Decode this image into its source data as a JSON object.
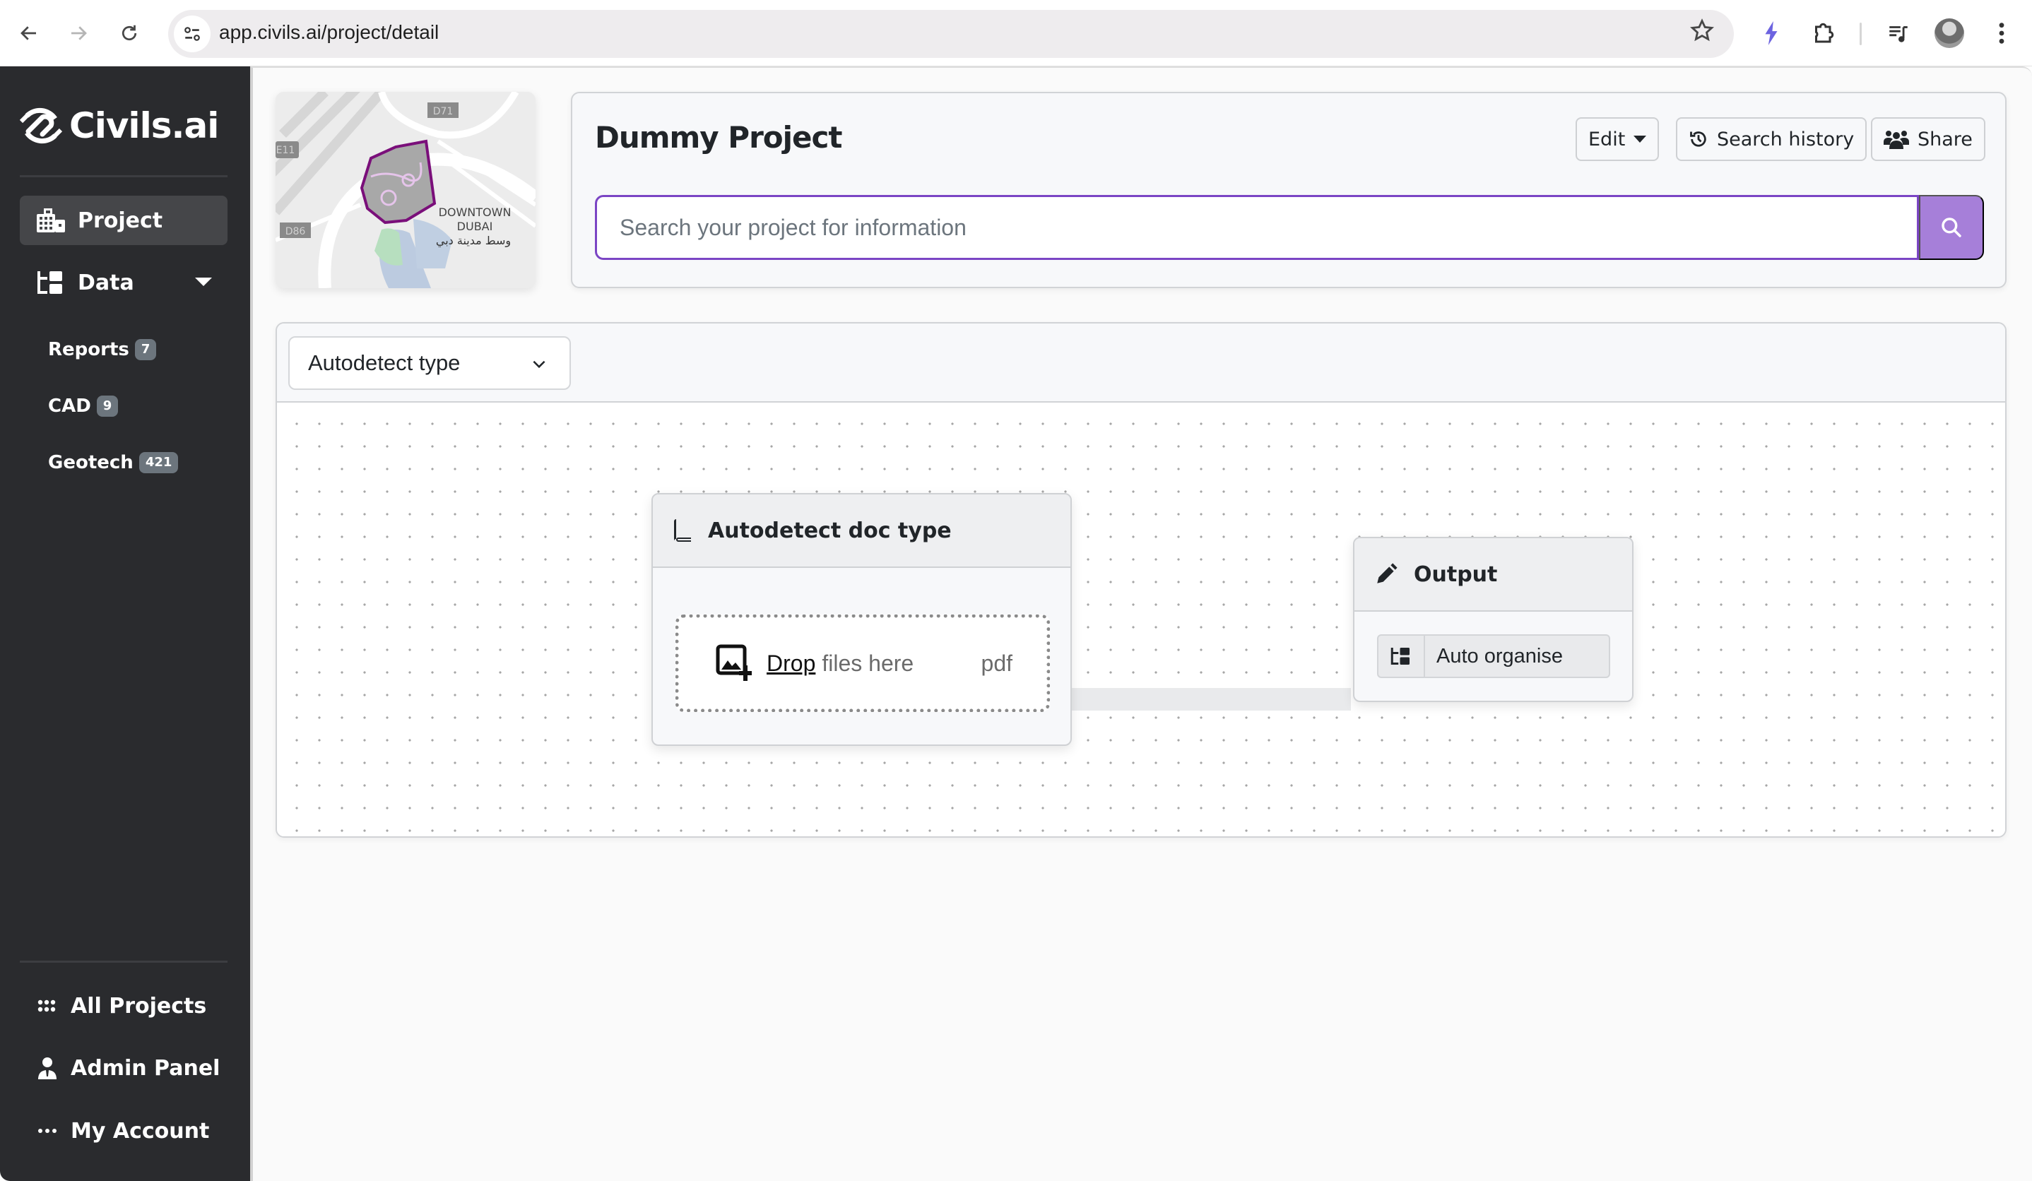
{
  "browser": {
    "url": "app.civils.ai/project/detail",
    "icons": [
      "back-icon",
      "forward-icon",
      "reload-icon",
      "site-info-icon",
      "bookmark-star-icon",
      "bolt-extension-icon",
      "extensions-puzzle-icon",
      "media-queue-icon",
      "profile-avatar",
      "kebab-menu-icon"
    ],
    "accent": "#6c63e0"
  },
  "sidebar": {
    "brand": "Civils.ai",
    "nav": [
      {
        "label": "Project",
        "icon": "building-icon",
        "active": true
      },
      {
        "label": "Data",
        "icon": "folder-tree-icon",
        "expanded": true
      }
    ],
    "data_items": [
      {
        "label": "Reports",
        "count": "7"
      },
      {
        "label": "CAD",
        "count": "9"
      },
      {
        "label": "Geotech",
        "count": "421"
      }
    ],
    "bottom": [
      {
        "label": "All Projects",
        "icon": "grid-dots-icon"
      },
      {
        "label": "Admin Panel",
        "icon": "user-tie-icon"
      },
      {
        "label": "My Account",
        "icon": "ellipsis-icon"
      }
    ],
    "background": "#2a2b2e"
  },
  "map": {
    "labels": {
      "district_en_1": "DOWNTOWN",
      "district_en_2": "DUBAI",
      "district_ar": "وسط مدينة دبي",
      "road_1": "D71",
      "road_2": "E11",
      "road_3": "D86"
    },
    "boundary_color": "#7a0f7a"
  },
  "header": {
    "project_title": "Dummy Project",
    "edit_label": "Edit",
    "search_history_label": "Search history",
    "share_label": "Share",
    "search_placeholder": "Search your project for information",
    "search_value": "",
    "search_accent": "#7b45c4",
    "search_button_color": "#a67fd9"
  },
  "workflow": {
    "type_select_value": "Autodetect type",
    "input_node": {
      "title": "Autodetect doc type",
      "drop_link": "Drop",
      "drop_text": "files here",
      "file_ext": "pdf"
    },
    "output_node": {
      "title": "Output",
      "action_label": "Auto organise"
    }
  }
}
